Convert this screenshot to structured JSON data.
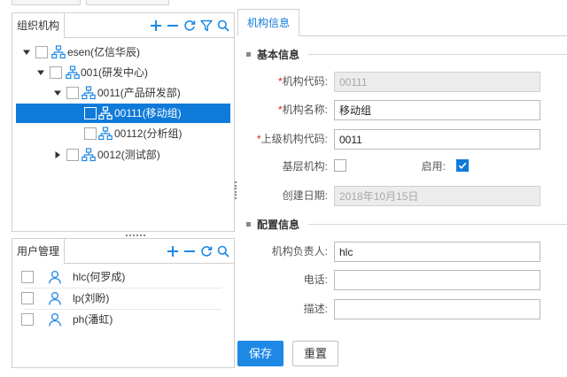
{
  "colors": {
    "accent": "#0f7ad9",
    "primary_button": "#1e88e5",
    "required": "#e02020"
  },
  "org_panel": {
    "title": "组织机构",
    "toolbar": [
      {
        "icon": "plus-icon"
      },
      {
        "icon": "minus-icon"
      },
      {
        "icon": "refresh-icon"
      },
      {
        "icon": "filter-icon"
      },
      {
        "icon": "search-icon"
      }
    ],
    "tree": [
      {
        "label": "esen(亿信华辰)",
        "level": 0,
        "expanded": true,
        "selected": false
      },
      {
        "label": "001(研发中心)",
        "level": 1,
        "expanded": true,
        "selected": false
      },
      {
        "label": "0011(产品研发部)",
        "level": 2,
        "expanded": true,
        "selected": false
      },
      {
        "label": "00111(移动组)",
        "level": 3,
        "expanded": null,
        "selected": true
      },
      {
        "label": "00112(分析组)",
        "level": 3,
        "expanded": null,
        "selected": false
      },
      {
        "label": "0012(测试部)",
        "level": 2,
        "expanded": false,
        "selected": false
      }
    ]
  },
  "user_panel": {
    "title": "用户管理",
    "toolbar": [
      {
        "icon": "plus-icon"
      },
      {
        "icon": "minus-icon"
      },
      {
        "icon": "refresh-icon"
      },
      {
        "icon": "search-icon"
      }
    ],
    "users": [
      {
        "label": "hlc(何罗成)"
      },
      {
        "label": "lp(刘盼)"
      },
      {
        "label": "ph(潘虹)"
      }
    ]
  },
  "detail": {
    "tab": "机构信息",
    "basic_section": "基本信息",
    "config_section": "配置信息",
    "fields": {
      "org_code": {
        "required_mark": "*",
        "label": "机构代码:",
        "value": "00111",
        "disabled": true
      },
      "org_name": {
        "required_mark": "*",
        "label": "机构名称:",
        "value": "移动组"
      },
      "parent_code": {
        "required_mark": "*",
        "label": "上级机构代码:",
        "value": "0011"
      },
      "is_base": {
        "label": "基层机构:",
        "checked": false
      },
      "enabled": {
        "label": "启用:",
        "checked": true
      },
      "created": {
        "label": "创建日期:",
        "value": "2018年10月15日",
        "disabled": true
      },
      "manager": {
        "label": "机构负责人:",
        "value": "hlc"
      },
      "phone": {
        "label": "电话:",
        "value": ""
      },
      "desc": {
        "label": "描述:",
        "value": ""
      }
    },
    "buttons": {
      "save": "保存",
      "reset": "重置"
    }
  }
}
